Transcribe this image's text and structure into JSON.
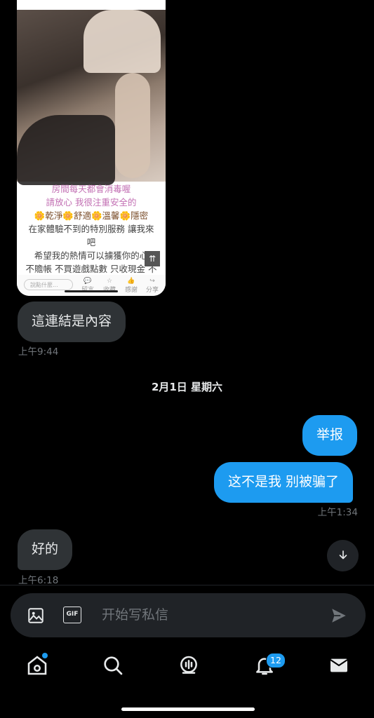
{
  "media_card": {
    "caption_lines": [
      {
        "text": "房間每天都會消毒喔",
        "cls": "pink"
      },
      {
        "text": "請放心 我很注重安全的",
        "cls": "pink"
      },
      {
        "text": "🌼乾淨🌼舒適🌼溫馨🌼隱密",
        "cls": "brown"
      },
      {
        "text": "在家體驗不到的特別服務 讓我來",
        "cls": "gray"
      },
      {
        "text": "吧",
        "cls": "gray"
      },
      {
        "text": "希望我的熱情可以擄獲你的心",
        "cls": "gray"
      },
      {
        "text": "不贍帳 不買遊戲點數 只收現金 不",
        "cls": "gray"
      }
    ],
    "input_placeholder": "說點什麼...",
    "icons": [
      "留言",
      "收藏",
      "感謝",
      "分享"
    ]
  },
  "messages": [
    {
      "text": "這連結是內容",
      "time": "上午9:44"
    },
    {
      "date": "2月1日 星期六"
    },
    {
      "text": "举报"
    },
    {
      "text": "这不是我 别被骗了",
      "time": "上午1:34"
    },
    {
      "text": "好的",
      "time": "上午6:18"
    }
  ],
  "composer": {
    "placeholder": "开始写私信",
    "gif_label": "GIF"
  },
  "nav": {
    "notifications_badge": "12"
  },
  "colors": {
    "accent": "#1d9bf0",
    "received_bubble": "#2f3336",
    "background": "#000000"
  }
}
